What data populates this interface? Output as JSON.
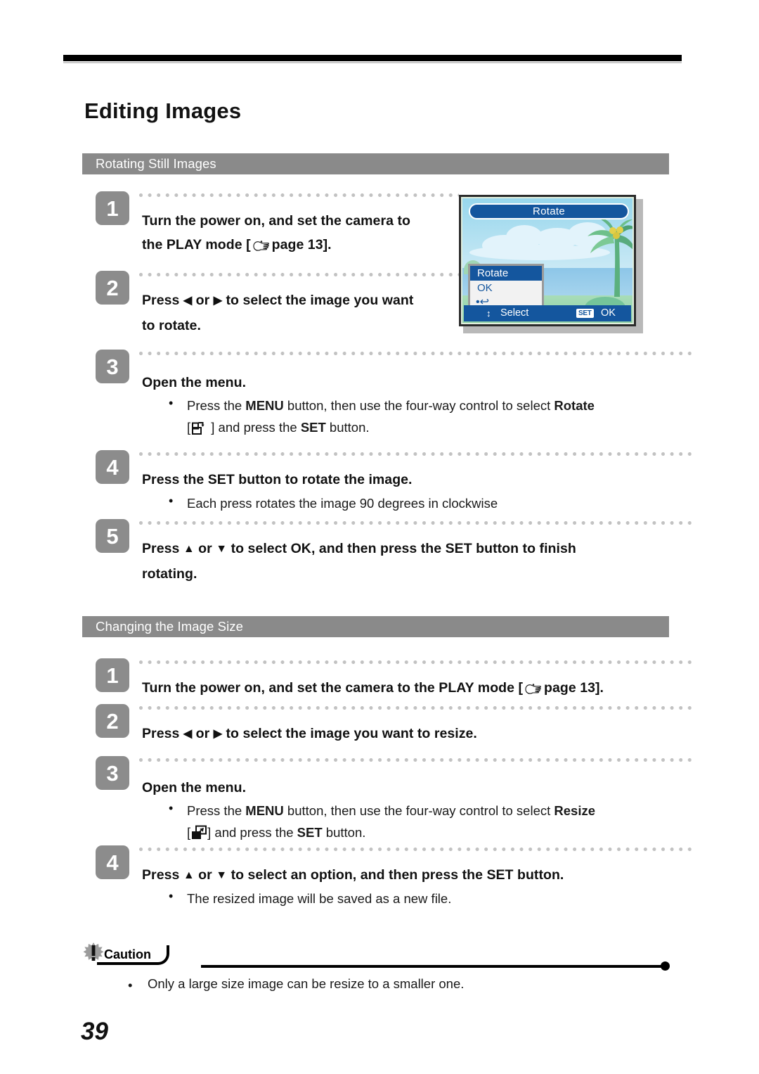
{
  "document": {
    "chapter_title": "Editing Images",
    "page_number": "39"
  },
  "sections": [
    {
      "id": "rotating",
      "header": "Rotating Still Images",
      "steps": [
        {
          "number": "1",
          "text_line1": "Turn the power on, and set the camera to",
          "text_line2_pre": "the PLAY mode [",
          "text_line2_post": "page 13]."
        },
        {
          "number": "2",
          "text_pre": "Press",
          "arrow_left": "◀",
          "text_or": "or",
          "arrow_right": "▶",
          "text_post": "to select the image you want",
          "text_line2": "to rotate."
        },
        {
          "number": "3",
          "text": "Open the menu.",
          "bullet_dot": "•",
          "bullet_pre": "Press the ",
          "bullet_menu": "MENU",
          "bullet_mid": " button, then use the four-way control to select ",
          "bullet_target": "Rotate",
          "bullet_line2_open": "[",
          "bullet_line2_mid": " ] and press the ",
          "bullet_set": "SET",
          "bullet_line2_end": " button."
        },
        {
          "number": "4",
          "text": "Press the SET button to rotate the image.",
          "bullet_dot": "•",
          "bullet_text": "Each press rotates the image 90 degrees in clockwise"
        },
        {
          "number": "5",
          "text_pre": "Press",
          "arrow_up": "▲",
          "text_or": "or",
          "arrow_down": "▼",
          "text_post": "to select OK, and then press the SET button to finish",
          "text_line2": "rotating."
        }
      ]
    },
    {
      "id": "resizing",
      "header": "Changing the Image Size",
      "steps": [
        {
          "number": "1",
          "text_pre": "Turn the power on, and set the camera to the PLAY mode [",
          "text_post": "page 13]."
        },
        {
          "number": "2",
          "text_pre": "Press",
          "arrow_left": "◀",
          "text_or": "or",
          "arrow_right": "▶",
          "text_post": "to select the image you want to resize."
        },
        {
          "number": "3",
          "text": "Open the menu.",
          "bullet_dot": "•",
          "bullet_pre": "Press the ",
          "bullet_menu": "MENU",
          "bullet_mid": " button, then use the four-way control to select ",
          "bullet_target": "Resize",
          "bullet_line2_open": "[",
          "bullet_line2_mid": "] and press the ",
          "bullet_set": "SET",
          "bullet_line2_end": " button."
        },
        {
          "number": "4",
          "text_pre": "Press",
          "arrow_up": "▲",
          "text_or": "or",
          "arrow_down": "▼",
          "text_post": "to select an option, and then press the SET button.",
          "bullet_dot": "•",
          "bullet_text": "The resized image will be saved as a new file."
        }
      ]
    }
  ],
  "lcd_screenshot": {
    "title": "Rotate",
    "menu_items": [
      "Rotate",
      "OK"
    ],
    "menu_return_glyph": "•↩",
    "status_updown_glyph": "↕",
    "status_select": "Select",
    "status_set_chip": "SET",
    "status_ok": "OK"
  },
  "caution": {
    "label": "Caution",
    "bullet_dot": "•",
    "text": "Only a large size image can be resize to a smaller one."
  },
  "colors": {
    "section_bar": "#8a8a8a",
    "step_badge": "#8c8c8c",
    "lcd_blue": "#14569e",
    "dot_gray": "#c2c2c2"
  }
}
